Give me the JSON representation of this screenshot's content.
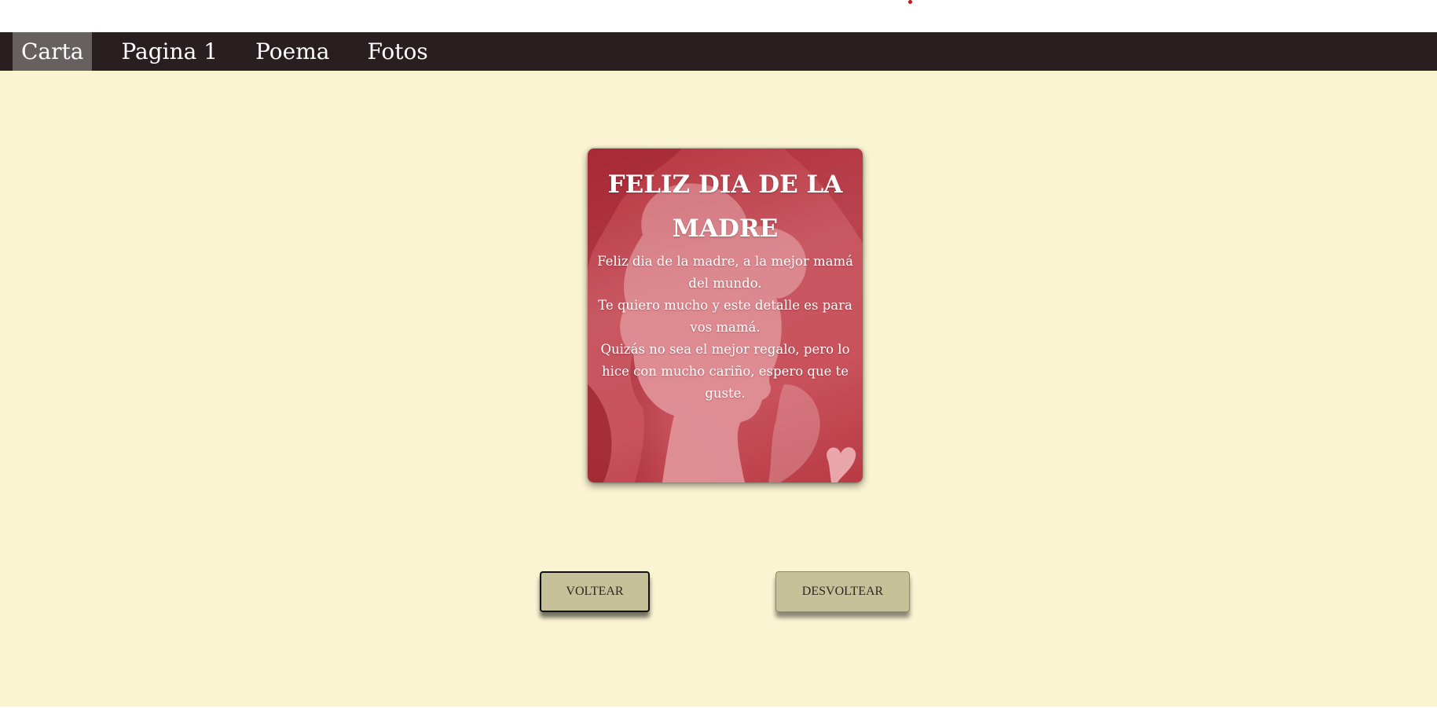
{
  "nav": {
    "items": [
      {
        "label": "Carta",
        "active": true
      },
      {
        "label": "Pagina 1",
        "active": false
      },
      {
        "label": "Poema",
        "active": false
      },
      {
        "label": "Fotos",
        "active": false
      }
    ]
  },
  "card": {
    "title": "FELIZ DIA DE LA MADRE",
    "lines": [
      "Feliz dia de la madre, a la mejor mamá del mundo.",
      "Te quiero mucho y este detalle es para vos mamá.",
      "Quizás no sea el mejor regalo, pero lo hice con mucho cariño, espero que te guste."
    ]
  },
  "buttons": {
    "flip": "VOLTEAR",
    "unflip": "DESVOLTEAR"
  },
  "colors": {
    "nav_bg": "#2a1f20",
    "nav_active": "#66605f",
    "page_bg": "#fbf4d2",
    "button_bg": "#c6c198",
    "card_red": "#c85862"
  }
}
